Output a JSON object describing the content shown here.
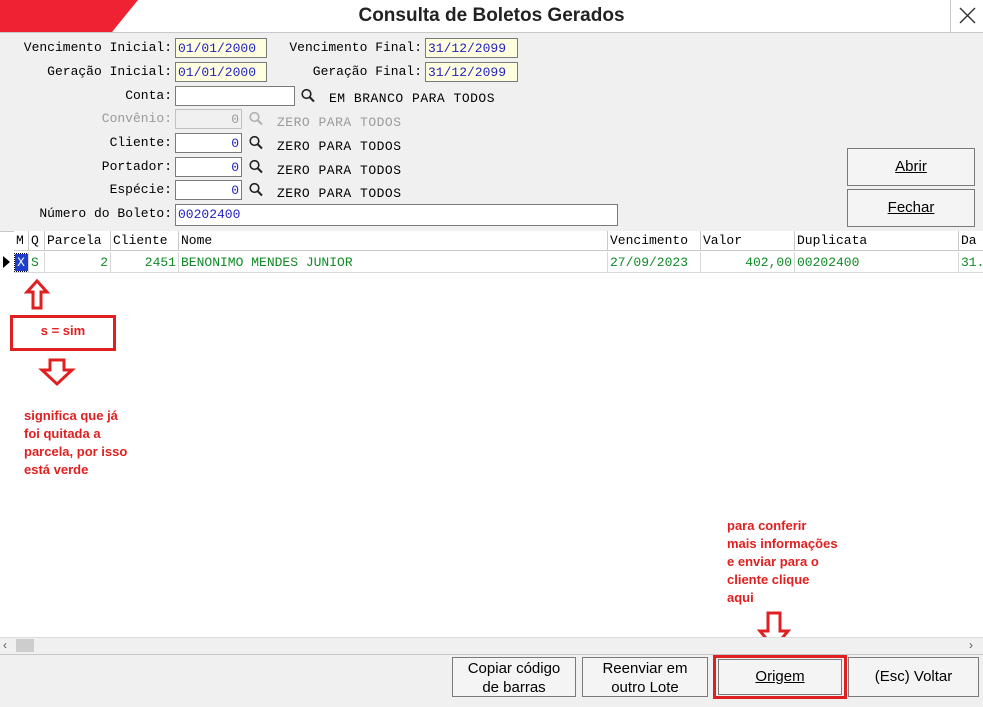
{
  "window": {
    "title": "Consulta de Boletos Gerados"
  },
  "filters": {
    "venc_inicial": {
      "label": "Vencimento Inicial:",
      "value": "01/01/2000"
    },
    "venc_final": {
      "label": "Vencimento Final:",
      "value": "31/12/2099"
    },
    "ger_inicial": {
      "label": "Geração Inicial:",
      "value": "01/01/2000"
    },
    "ger_final": {
      "label": "Geração Final:",
      "value": "31/12/2099"
    },
    "conta": {
      "label": "Conta:",
      "value": "",
      "hint": "EM BRANCO PARA TODOS"
    },
    "convenio": {
      "label": "Convênio:",
      "value": "0",
      "hint": "ZERO PARA TODOS"
    },
    "cliente": {
      "label": "Cliente:",
      "value": "0",
      "hint": "ZERO PARA TODOS"
    },
    "portador": {
      "label": "Portador:",
      "value": "0",
      "hint": "ZERO PARA TODOS"
    },
    "especie": {
      "label": "Espécie:",
      "value": "0",
      "hint": "ZERO PARA TODOS"
    },
    "numero_boleto": {
      "label": "Número do Boleto:",
      "value": "00202400"
    }
  },
  "actions": {
    "abrir": "Abrir",
    "fechar": "Fechar"
  },
  "grid": {
    "columns": [
      "M",
      "Q",
      "Parcela",
      "Cliente",
      "Nome",
      "Vencimento",
      "Valor",
      "Duplicata",
      "Da"
    ],
    "rows": [
      {
        "m": "X",
        "q": "S",
        "parcela": "2",
        "cliente": "2451",
        "nome": "BENONIMO MENDES JUNIOR",
        "vencimento": "27/09/2023",
        "valor": "402,00",
        "duplicata": "00202400",
        "data": "31."
      }
    ]
  },
  "annotations": {
    "s_sim": "s = sim",
    "quitada": [
      "significa que já",
      "foi quitada a",
      "parcela, por isso",
      "está verde"
    ],
    "origem_info": [
      "para conferir",
      "mais informações",
      "e enviar para o",
      "cliente clique",
      "aqui"
    ]
  },
  "bottom": {
    "copiar": [
      "Copiar código",
      "de barras"
    ],
    "reenviar": [
      "Reenviar em",
      "outro Lote"
    ],
    "origem": "Origem",
    "voltar_prefix": "(Esc) ",
    "voltar": "Voltar"
  },
  "colors": {
    "accent_red": "#ee2233",
    "paid_green": "#0f8a26",
    "value_blue": "#1f1fbf",
    "annotation_red": "#e02020"
  }
}
